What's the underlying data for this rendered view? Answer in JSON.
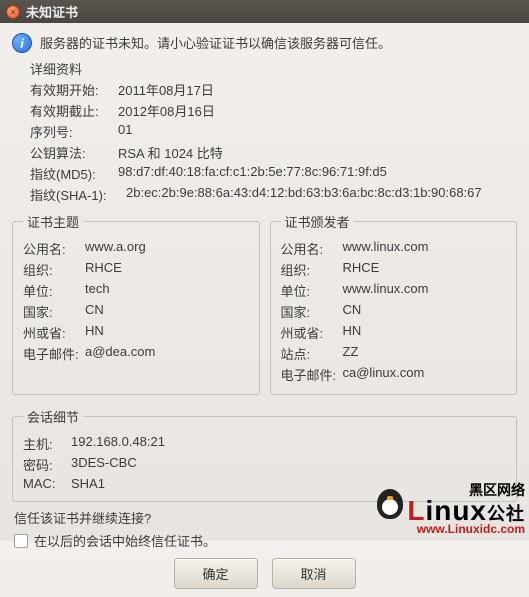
{
  "window": {
    "title": "未知证书",
    "close_glyph": "×"
  },
  "message": "服务器的证书未知。请小心验证证书以确信该服务器可信任。",
  "info_glyph": "i",
  "details": {
    "heading": "详细资料",
    "valid_from": {
      "label": "有效期开始:",
      "value": "2011年08月17日"
    },
    "valid_to": {
      "label": "有效期截止:",
      "value": "2012年08月16日"
    },
    "serial": {
      "label": "序列号:",
      "value": "01"
    },
    "pubkey": {
      "label": "公钥算法:",
      "value": "RSA 和 1024 比特"
    },
    "md5": {
      "label": "指纹(MD5):",
      "value": "98:d7:df:40:18:fa:cf:c1:2b:5e:77:8c:96:71:9f:d5"
    },
    "sha1": {
      "label": "指纹(SHA-1):",
      "value": "2b:ec:2b:9e:88:6a:43:d4:12:bd:63:b3:6a:bc:8c:d3:1b:90:68:67"
    }
  },
  "subject": {
    "legend": "证书主题",
    "cn": {
      "label": "公用名:",
      "value": "www.a.org"
    },
    "org": {
      "label": "组织:",
      "value": "RHCE"
    },
    "unit": {
      "label": "单位:",
      "value": "tech"
    },
    "country": {
      "label": "国家:",
      "value": "CN"
    },
    "state": {
      "label": "州或省:",
      "value": "HN"
    },
    "email": {
      "label": "电子邮件:",
      "value": "a@dea.com"
    }
  },
  "issuer": {
    "legend": "证书颁发者",
    "cn": {
      "label": "公用名:",
      "value": "www.linux.com"
    },
    "org": {
      "label": "组织:",
      "value": "RHCE"
    },
    "unit": {
      "label": "单位:",
      "value": "www.linux.com"
    },
    "country": {
      "label": "国家:",
      "value": "CN"
    },
    "state": {
      "label": "州或省:",
      "value": "HN"
    },
    "site": {
      "label": "站点:",
      "value": "ZZ"
    },
    "email": {
      "label": "电子邮件:",
      "value": "ca@linux.com"
    }
  },
  "session": {
    "legend": "会话细节",
    "host": {
      "label": "主机:",
      "value": "192.168.0.48:21"
    },
    "cipher": {
      "label": "密码:",
      "value": "3DES-CBC"
    },
    "mac": {
      "label": "MAC:",
      "value": "SHA1"
    }
  },
  "trust": {
    "question": "信任该证书并继续连接?",
    "checkbox_label": "在以后的会话中始终信任证书。"
  },
  "buttons": {
    "ok": "确定",
    "cancel": "取消"
  },
  "watermark": {
    "cn": "黑区网络",
    "brand_l": "L",
    "brand_inux": "inux",
    "brand_suffix": "公社",
    "url": "www.Linuxidc.com"
  }
}
